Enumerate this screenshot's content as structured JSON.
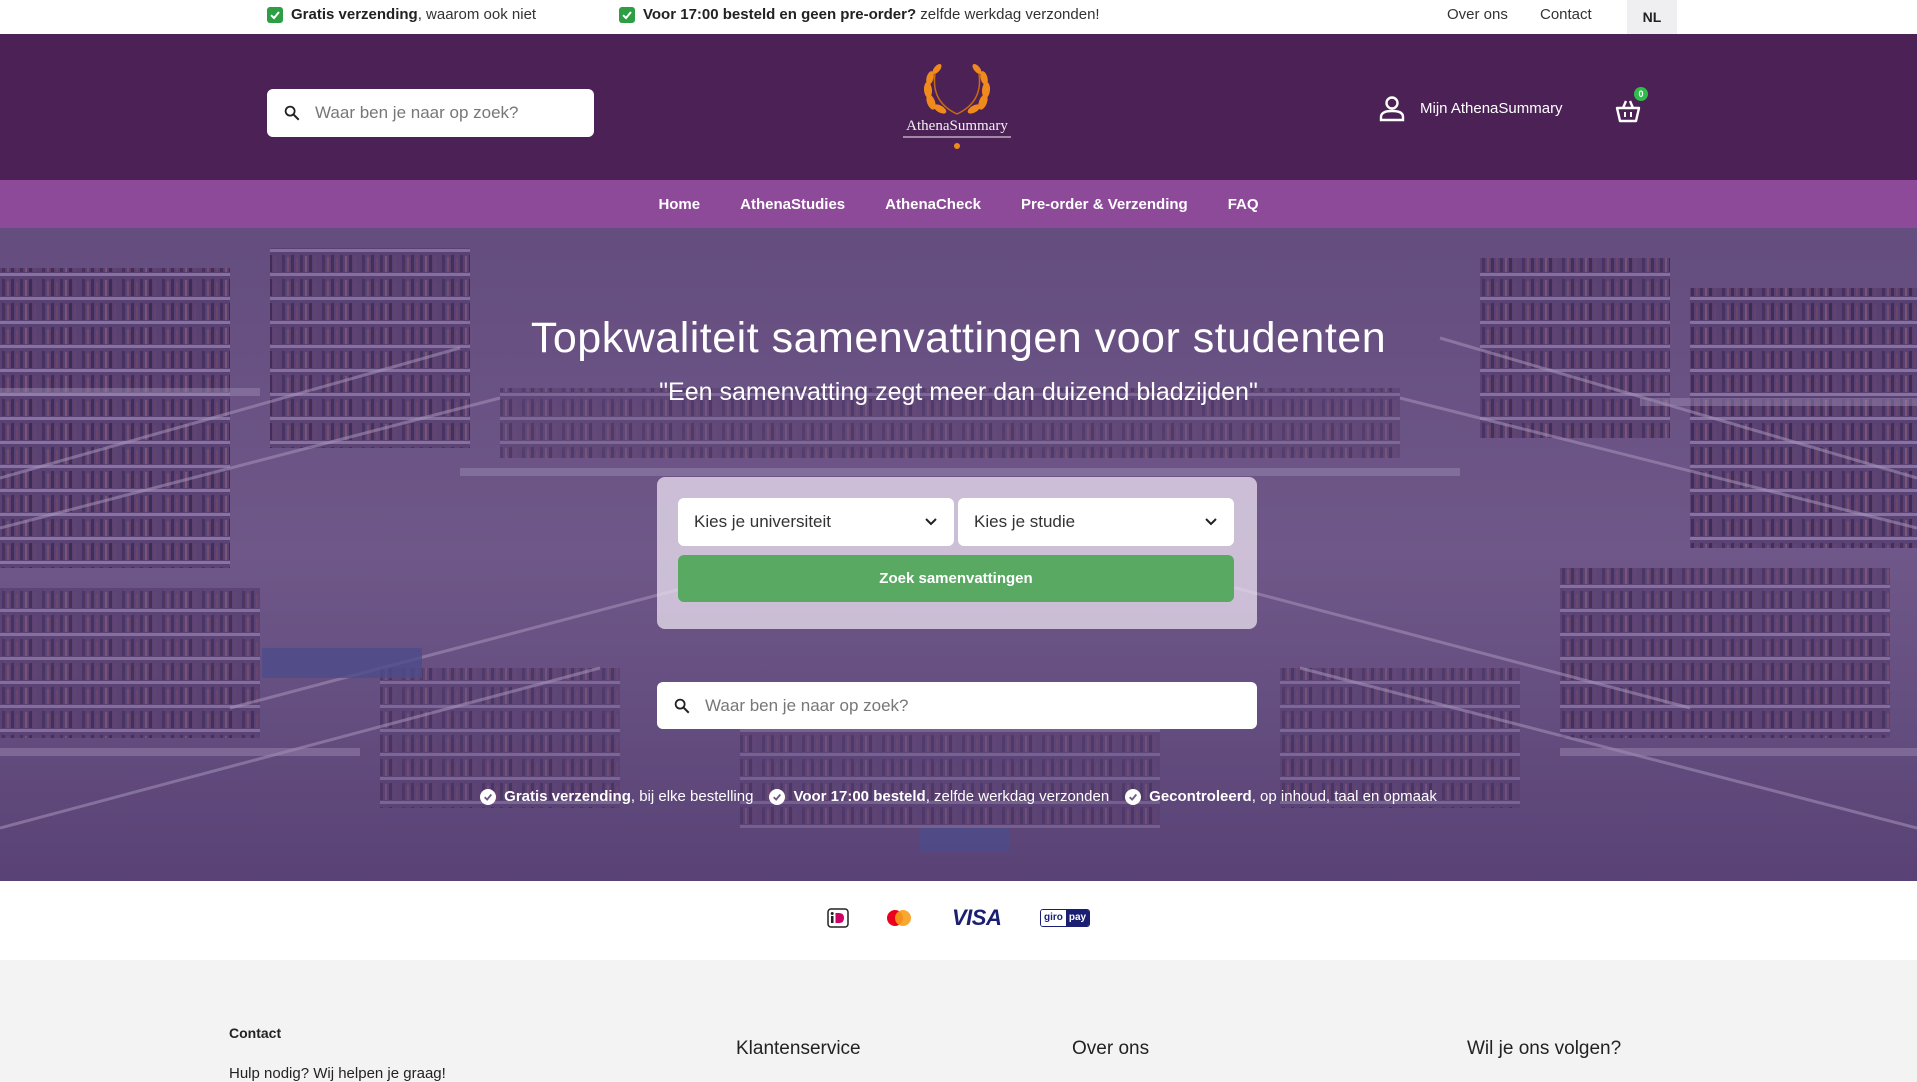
{
  "topbar": {
    "usp1_bold": "Gratis verzending",
    "usp1_rest": ", waarom ook niet",
    "usp2_bold": "Voor 17:00 besteld en geen pre-order?",
    "usp2_rest": " zelfde werkdag verzonden!",
    "about": "Over ons",
    "contact": "Contact",
    "lang": "NL"
  },
  "header": {
    "search_placeholder": "Waar ben je naar op zoek?",
    "logo_text": "AthenaSummary",
    "account_label": "Mijn AthenaSummary",
    "cart_count": "0"
  },
  "nav": {
    "items": [
      {
        "label": "Home"
      },
      {
        "label": "AthenaStudies"
      },
      {
        "label": "AthenaCheck"
      },
      {
        "label": "Pre-order & Verzending"
      },
      {
        "label": "FAQ"
      }
    ]
  },
  "hero": {
    "title": "Topkwaliteit samenvattingen voor studenten",
    "subtitle": "\"Een samenvatting zegt meer dan duizend bladzijden\"",
    "university_select": "Kies je universiteit",
    "study_select": "Kies je studie",
    "find_button": "Zoek samenvattingen",
    "search_placeholder": "Waar ben je naar op zoek?",
    "usps": [
      {
        "bold": "Gratis verzending",
        "rest": ", bij elke bestelling"
      },
      {
        "bold": "Voor 17:00 besteld",
        "rest": ", zelfde werkdag verzonden"
      },
      {
        "bold": "Gecontroleerd",
        "rest": ", op inhoud, taal en opmaak"
      }
    ]
  },
  "payments": {
    "methods": [
      "ideal-icon",
      "mastercard-icon",
      "visa-icon",
      "giropay-icon"
    ],
    "visa": "VISA",
    "giro": "giro",
    "pay": "pay"
  },
  "footer": {
    "contact_heading": "Contact",
    "help_text": "Hulp nodig? Wij helpen je graag!",
    "col_service": "Klantenservice",
    "col_about": "Over ons",
    "col_follow": "Wil je ons volgen?"
  },
  "colors": {
    "header": "#4b2156",
    "nav": "#8c4a98",
    "button": "#59a963",
    "check": "#2e9e45"
  }
}
